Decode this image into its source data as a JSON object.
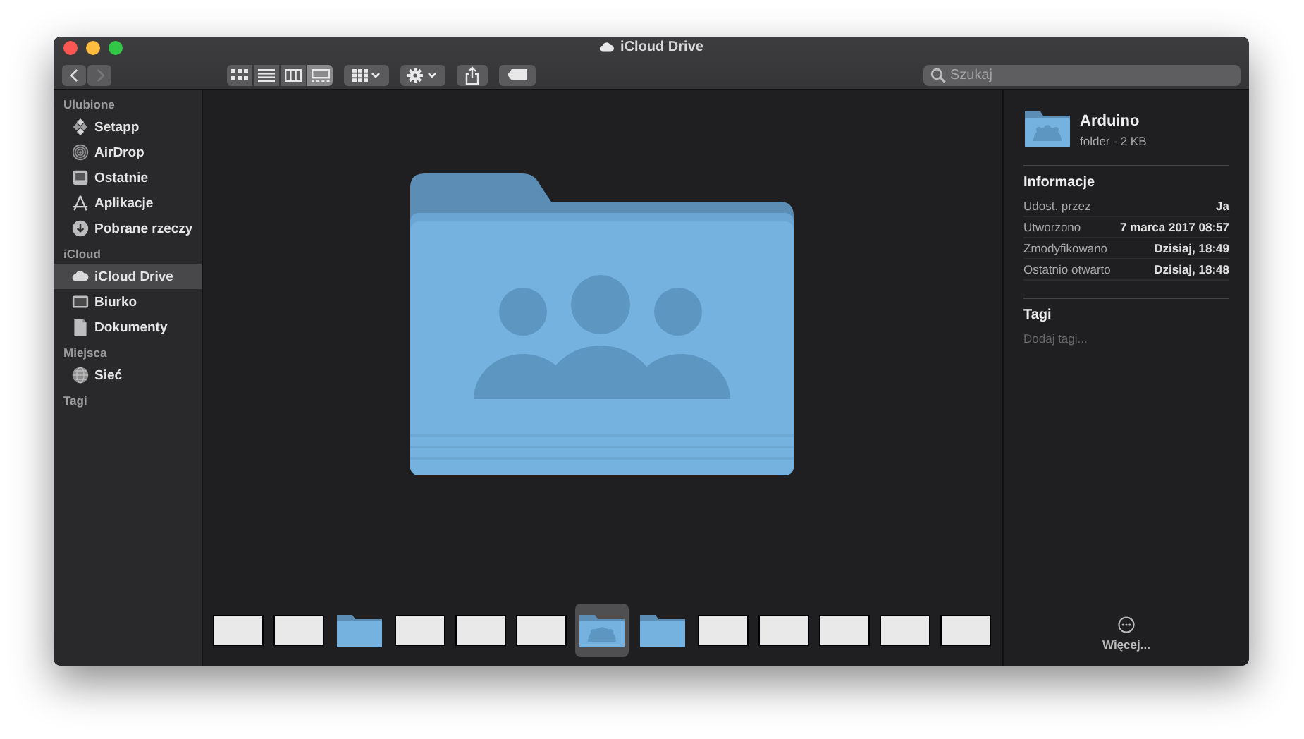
{
  "window": {
    "title": "iCloud Drive"
  },
  "toolbar": {
    "view_buttons": [
      {
        "kind": "icons",
        "selected": false
      },
      {
        "kind": "list",
        "selected": false
      },
      {
        "kind": "columns",
        "selected": false
      },
      {
        "kind": "gallery",
        "selected": true
      }
    ]
  },
  "search": {
    "placeholder": "Szukaj"
  },
  "sidebar": {
    "sections": [
      {
        "title": "Ulubione",
        "items": [
          {
            "label": "Setapp",
            "kind": "app",
            "selected": false
          },
          {
            "label": "AirDrop",
            "kind": "airdrop",
            "selected": false
          },
          {
            "label": "Ostatnie",
            "kind": "recent",
            "selected": false
          },
          {
            "label": "Aplikacje",
            "kind": "apps",
            "selected": false
          },
          {
            "label": "Pobrane rzeczy",
            "kind": "download",
            "selected": false
          }
        ]
      },
      {
        "title": "iCloud",
        "items": [
          {
            "label": "iCloud Drive",
            "kind": "cloud",
            "selected": true
          },
          {
            "label": "Biurko",
            "kind": "desktop",
            "selected": false
          },
          {
            "label": "Dokumenty",
            "kind": "document",
            "selected": false
          }
        ]
      },
      {
        "title": "Miejsca",
        "items": [
          {
            "label": "Sieć",
            "kind": "network",
            "selected": false
          }
        ]
      },
      {
        "title": "Tagi"
      }
    ]
  },
  "filmstrip": [
    {
      "kind": "photo",
      "selected": false
    },
    {
      "kind": "photo",
      "selected": false
    },
    {
      "kind": "folder",
      "selected": false
    },
    {
      "kind": "photo",
      "selected": false
    },
    {
      "kind": "photo",
      "selected": false
    },
    {
      "kind": "photo",
      "selected": false
    },
    {
      "kind": "shared-folder",
      "selected": true
    },
    {
      "kind": "folder",
      "selected": false
    },
    {
      "kind": "photo",
      "selected": false
    },
    {
      "kind": "photo",
      "selected": false
    },
    {
      "kind": "photo",
      "selected": false
    },
    {
      "kind": "photo",
      "selected": false
    },
    {
      "kind": "photo",
      "selected": false
    }
  ],
  "inspector": {
    "name": "Arduino",
    "subtitle": "folder - 2 KB",
    "info_title": "Informacje",
    "info_rows": [
      {
        "label": "Udost. przez",
        "value": "Ja"
      },
      {
        "label": "Utworzono",
        "value": "7 marca 2017 08:57"
      },
      {
        "label": "Zmodyfikowano",
        "value": "Dzisiaj, 18:49"
      },
      {
        "label": "Ostatnio otwarto",
        "value": "Dzisiaj, 18:48"
      }
    ],
    "tags_title": "Tagi",
    "tags_placeholder": "Dodaj tagi...",
    "more_label": "Więcej..."
  }
}
